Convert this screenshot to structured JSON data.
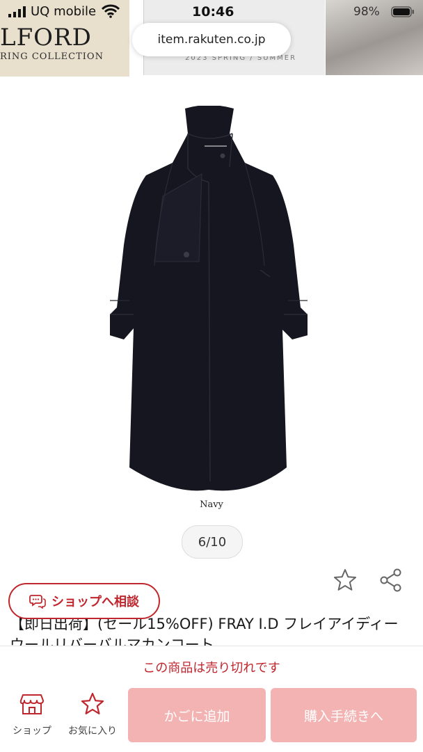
{
  "status_bar": {
    "carrier": "UQ mobile",
    "time": "10:46",
    "battery": "98%"
  },
  "banner": {
    "brand": "LFORD",
    "subtitle": "RING COLLECTION",
    "mid_text": "2023 SPRING / SUMMER"
  },
  "browser": {
    "url": "item.rakuten.co.jp"
  },
  "product": {
    "image_caption": "Navy",
    "pager": "6/10",
    "title": "【即日出荷】(セール15%OFF) FRAY I.D フレイアイディー ウールリバーバルマカンコート"
  },
  "actions": {
    "consult_label": "ショップへ相談"
  },
  "bottom_bar": {
    "soldout_message": "この商品は売り切れです",
    "shop_label": "ショップ",
    "favorite_label": "お気に入り",
    "cart_label": "かごに追加",
    "buy_label": "購入手続きへ"
  },
  "colors": {
    "accent": "#c0262d",
    "disabled_button": "#f3b3b3",
    "coat": "#15161f"
  }
}
